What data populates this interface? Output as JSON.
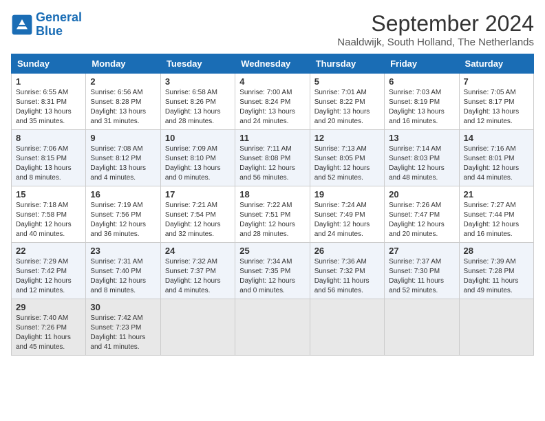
{
  "header": {
    "logo_line1": "General",
    "logo_line2": "Blue",
    "month_title": "September 2024",
    "location": "Naaldwijk, South Holland, The Netherlands"
  },
  "weekdays": [
    "Sunday",
    "Monday",
    "Tuesday",
    "Wednesday",
    "Thursday",
    "Friday",
    "Saturday"
  ],
  "weeks": [
    [
      {
        "day": "1",
        "info": "Sunrise: 6:55 AM\nSunset: 8:31 PM\nDaylight: 13 hours and 35 minutes."
      },
      {
        "day": "2",
        "info": "Sunrise: 6:56 AM\nSunset: 8:28 PM\nDaylight: 13 hours and 31 minutes."
      },
      {
        "day": "3",
        "info": "Sunrise: 6:58 AM\nSunset: 8:26 PM\nDaylight: 13 hours and 28 minutes."
      },
      {
        "day": "4",
        "info": "Sunrise: 7:00 AM\nSunset: 8:24 PM\nDaylight: 13 hours and 24 minutes."
      },
      {
        "day": "5",
        "info": "Sunrise: 7:01 AM\nSunset: 8:22 PM\nDaylight: 13 hours and 20 minutes."
      },
      {
        "day": "6",
        "info": "Sunrise: 7:03 AM\nSunset: 8:19 PM\nDaylight: 13 hours and 16 minutes."
      },
      {
        "day": "7",
        "info": "Sunrise: 7:05 AM\nSunset: 8:17 PM\nDaylight: 13 hours and 12 minutes."
      }
    ],
    [
      {
        "day": "8",
        "info": "Sunrise: 7:06 AM\nSunset: 8:15 PM\nDaylight: 13 hours and 8 minutes."
      },
      {
        "day": "9",
        "info": "Sunrise: 7:08 AM\nSunset: 8:12 PM\nDaylight: 13 hours and 4 minutes."
      },
      {
        "day": "10",
        "info": "Sunrise: 7:09 AM\nSunset: 8:10 PM\nDaylight: 13 hours and 0 minutes."
      },
      {
        "day": "11",
        "info": "Sunrise: 7:11 AM\nSunset: 8:08 PM\nDaylight: 12 hours and 56 minutes."
      },
      {
        "day": "12",
        "info": "Sunrise: 7:13 AM\nSunset: 8:05 PM\nDaylight: 12 hours and 52 minutes."
      },
      {
        "day": "13",
        "info": "Sunrise: 7:14 AM\nSunset: 8:03 PM\nDaylight: 12 hours and 48 minutes."
      },
      {
        "day": "14",
        "info": "Sunrise: 7:16 AM\nSunset: 8:01 PM\nDaylight: 12 hours and 44 minutes."
      }
    ],
    [
      {
        "day": "15",
        "info": "Sunrise: 7:18 AM\nSunset: 7:58 PM\nDaylight: 12 hours and 40 minutes."
      },
      {
        "day": "16",
        "info": "Sunrise: 7:19 AM\nSunset: 7:56 PM\nDaylight: 12 hours and 36 minutes."
      },
      {
        "day": "17",
        "info": "Sunrise: 7:21 AM\nSunset: 7:54 PM\nDaylight: 12 hours and 32 minutes."
      },
      {
        "day": "18",
        "info": "Sunrise: 7:22 AM\nSunset: 7:51 PM\nDaylight: 12 hours and 28 minutes."
      },
      {
        "day": "19",
        "info": "Sunrise: 7:24 AM\nSunset: 7:49 PM\nDaylight: 12 hours and 24 minutes."
      },
      {
        "day": "20",
        "info": "Sunrise: 7:26 AM\nSunset: 7:47 PM\nDaylight: 12 hours and 20 minutes."
      },
      {
        "day": "21",
        "info": "Sunrise: 7:27 AM\nSunset: 7:44 PM\nDaylight: 12 hours and 16 minutes."
      }
    ],
    [
      {
        "day": "22",
        "info": "Sunrise: 7:29 AM\nSunset: 7:42 PM\nDaylight: 12 hours and 12 minutes."
      },
      {
        "day": "23",
        "info": "Sunrise: 7:31 AM\nSunset: 7:40 PM\nDaylight: 12 hours and 8 minutes."
      },
      {
        "day": "24",
        "info": "Sunrise: 7:32 AM\nSunset: 7:37 PM\nDaylight: 12 hours and 4 minutes."
      },
      {
        "day": "25",
        "info": "Sunrise: 7:34 AM\nSunset: 7:35 PM\nDaylight: 12 hours and 0 minutes."
      },
      {
        "day": "26",
        "info": "Sunrise: 7:36 AM\nSunset: 7:32 PM\nDaylight: 11 hours and 56 minutes."
      },
      {
        "day": "27",
        "info": "Sunrise: 7:37 AM\nSunset: 7:30 PM\nDaylight: 11 hours and 52 minutes."
      },
      {
        "day": "28",
        "info": "Sunrise: 7:39 AM\nSunset: 7:28 PM\nDaylight: 11 hours and 49 minutes."
      }
    ],
    [
      {
        "day": "29",
        "info": "Sunrise: 7:40 AM\nSunset: 7:26 PM\nDaylight: 11 hours and 45 minutes."
      },
      {
        "day": "30",
        "info": "Sunrise: 7:42 AM\nSunset: 7:23 PM\nDaylight: 11 hours and 41 minutes."
      },
      {
        "day": "",
        "info": ""
      },
      {
        "day": "",
        "info": ""
      },
      {
        "day": "",
        "info": ""
      },
      {
        "day": "",
        "info": ""
      },
      {
        "day": "",
        "info": ""
      }
    ]
  ]
}
